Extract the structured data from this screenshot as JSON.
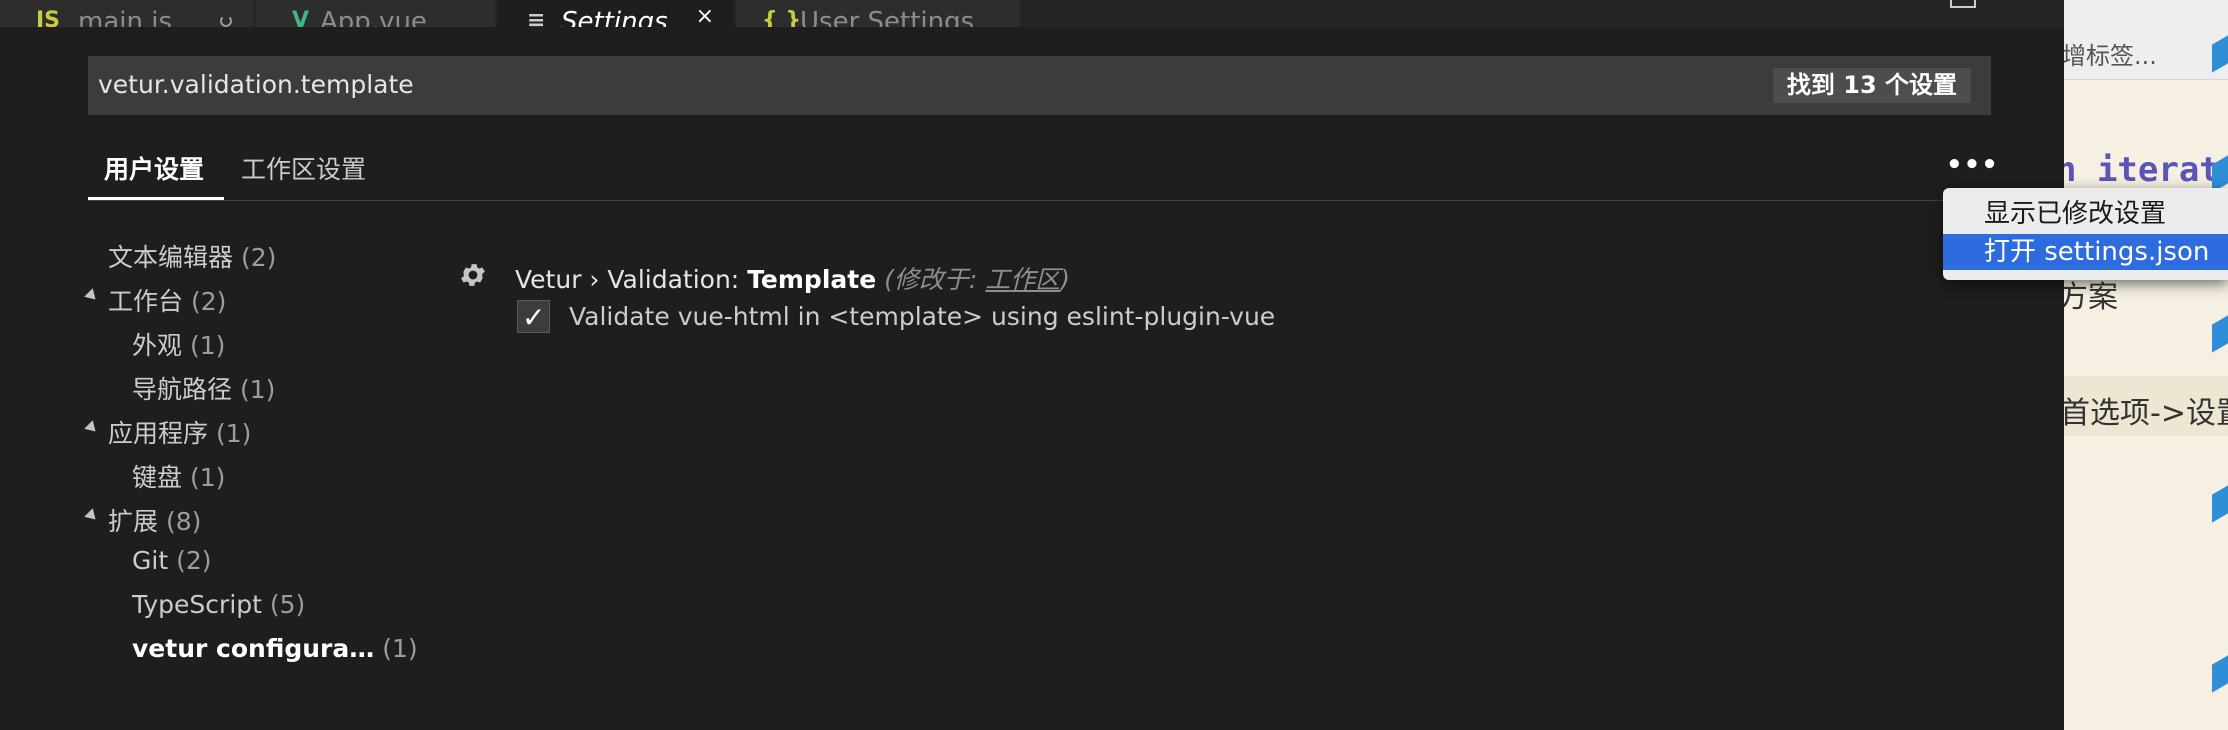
{
  "tabs": [
    {
      "label": "main.js",
      "icon": "JS",
      "icon_color": "#cbcb41",
      "dirty": true
    },
    {
      "label": "App.vue",
      "icon": "V",
      "icon_color": "#41b883"
    },
    {
      "label": "Settings",
      "icon": "≡",
      "icon_color": "#cccccc",
      "active": true,
      "close": "×"
    },
    {
      "label": "User Settings",
      "icon": "{ }",
      "icon_color": "#cbcb41"
    }
  ],
  "search": {
    "value": "vetur.validation.template",
    "result_count": "找到 13 个设置"
  },
  "scope_tabs": {
    "user": "用户设置",
    "workspace": "工作区设置",
    "more": "•••"
  },
  "toc": [
    {
      "label": "文本编辑器",
      "count": "(2)"
    },
    {
      "label": "工作台",
      "count": "(2)"
    },
    {
      "label": "外观",
      "count": "(1)"
    },
    {
      "label": "导航路径",
      "count": "(1)"
    },
    {
      "label": "应用程序",
      "count": "(1)"
    },
    {
      "label": "键盘",
      "count": "(1)"
    },
    {
      "label": "扩展",
      "count": "(8)"
    },
    {
      "label": "Git",
      "count": "(2)"
    },
    {
      "label": "TypeScript",
      "count": "(5)"
    },
    {
      "label": "vetur configura…",
      "count": "(1)"
    }
  ],
  "setting": {
    "category": "Vetur › Validation:",
    "name": "Template",
    "modified_prefix": "(修改于:",
    "modified_link": "工作区",
    "modified_suffix": ")",
    "description": "Validate vue-html in <template> using eslint-plugin-vue",
    "checked": true,
    "check_mark": "✓"
  },
  "context_menu": {
    "items": [
      "显示已修改设置",
      "打开 settings.json"
    ],
    "selected_index": 1
  },
  "background_window": {
    "tag_hint": "增标签...",
    "code": "n iterati",
    "line2": "方案",
    "line3": "首选项->设置"
  },
  "colors": {
    "editor_bg": "#1e1e1e",
    "menu_highlight": "#2d6cdf",
    "accent_blue": "#2f8ed8"
  }
}
